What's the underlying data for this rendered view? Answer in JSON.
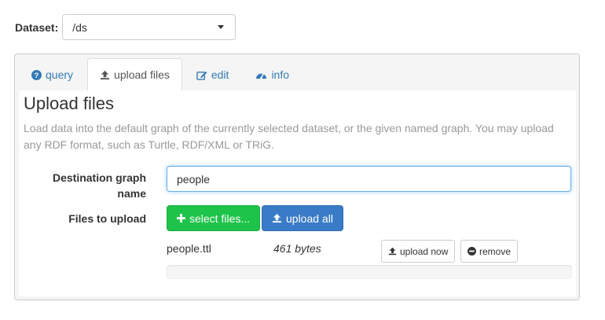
{
  "dataset": {
    "label": "Dataset:",
    "selected": "/ds"
  },
  "tabs": [
    {
      "label": "query",
      "icon": "question-circle-icon"
    },
    {
      "label": "upload files",
      "icon": "upload-icon"
    },
    {
      "label": "edit",
      "icon": "edit-icon"
    },
    {
      "label": "info",
      "icon": "dashboard-icon"
    }
  ],
  "upload": {
    "title": "Upload files",
    "description": "Load data into the default graph of the currently selected dataset, or the given named graph. You may upload any RDF format, such as Turtle, RDF/XML or TRiG.",
    "dest_label_line1": "Destination graph",
    "dest_label_line2": "name",
    "dest_value": "people",
    "files_label": "Files to upload",
    "select_files": "select files...",
    "upload_all": "upload all",
    "file": {
      "name": "people.ttl",
      "size": "461 bytes",
      "upload_now": "upload now",
      "remove": "remove",
      "progress": 0
    }
  },
  "colors": {
    "link": "#337ab7",
    "success": "#1ec34a",
    "primary": "#3a7bc8"
  }
}
